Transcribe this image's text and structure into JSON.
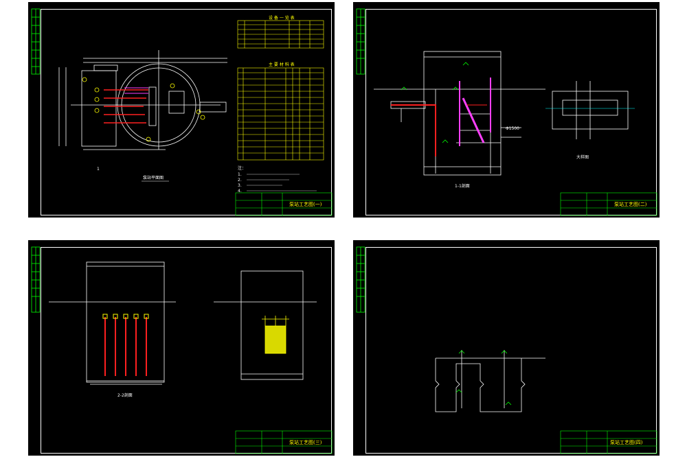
{
  "sheets": [
    {
      "id": "sheet-1",
      "title_block_title": "泵站工艺图(一)",
      "view_label": "泵站平面图",
      "section_mark": "1",
      "table_1_title": "设 备 一 览 表",
      "table_2_title": "主 要 材 料 表",
      "notes_heading": "注：",
      "note_lines": [
        "1.",
        "2.",
        "3.",
        "4."
      ]
    },
    {
      "id": "sheet-2",
      "title_block_title": "泵站工艺图(二)",
      "view_label": "1-1剖面",
      "detail_label": "大样图",
      "dim_label": "Φ1500"
    },
    {
      "id": "sheet-3",
      "title_block_title": "泵站工艺图(三)",
      "view_label": "2-2剖面"
    },
    {
      "id": "sheet-4",
      "title_block_title": "泵站工艺图(四)"
    }
  ],
  "colors": {
    "background": "#000000",
    "line": "#ffffff",
    "table": "#ffff00",
    "border_strip": "#00ff00",
    "pipe_red": "#ff2020",
    "pipe_magenta": "#ff40ff",
    "accent_cyan": "#00ffff"
  }
}
